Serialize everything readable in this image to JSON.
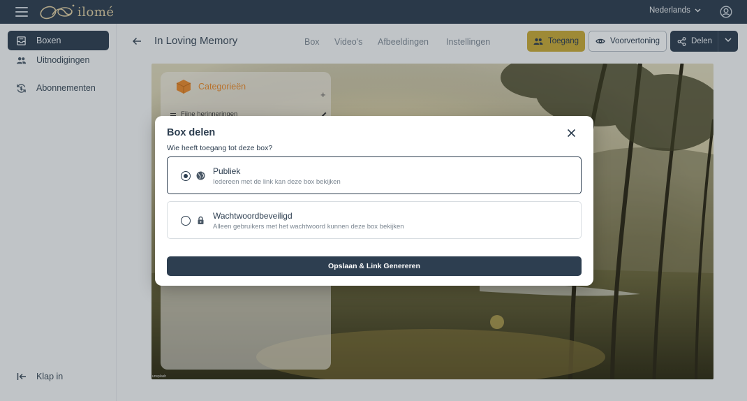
{
  "app": {
    "logo_text": "ilomé"
  },
  "topbar": {
    "language": "Nederlands"
  },
  "sidebar": {
    "items": [
      {
        "label": "Boxen",
        "icon": "inbox-icon",
        "active": true
      },
      {
        "label": "Uitnodigingen",
        "icon": "people-icon",
        "active": false
      },
      {
        "label": "Abonnementen",
        "icon": "refresh-dollar-icon",
        "active": false
      }
    ],
    "collapse_label": "Klap in"
  },
  "header": {
    "title": "In Loving Memory",
    "tabs": [
      "Box",
      "Video's",
      "Afbeeldingen",
      "Instellingen"
    ],
    "buttons": {
      "access": "Toegang",
      "preview": "Voorvertoning",
      "share": "Delen"
    }
  },
  "categories": {
    "title": "Categorieën",
    "add": "+",
    "items": [
      "Fijne herinneringen"
    ]
  },
  "photo": {
    "credit": "unsplash"
  },
  "modal": {
    "title": "Box delen",
    "question": "Wie heeft toegang tot deze box?",
    "options": [
      {
        "title": "Publiek",
        "description": "Iedereen met de link kan deze box bekijken",
        "icon": "globe-icon",
        "selected": true
      },
      {
        "title": "Wachtwoordbeveiligd",
        "description": "Alleen gebruikers met het wachtwoord kunnen deze box bekijken",
        "icon": "lock-icon",
        "selected": false
      }
    ],
    "submit": "Opslaan & Link Genereren"
  },
  "colors": {
    "navy": "#2d3e50",
    "gold": "#c2a638",
    "orange": "#e2872d",
    "background": "#eef0f1"
  }
}
